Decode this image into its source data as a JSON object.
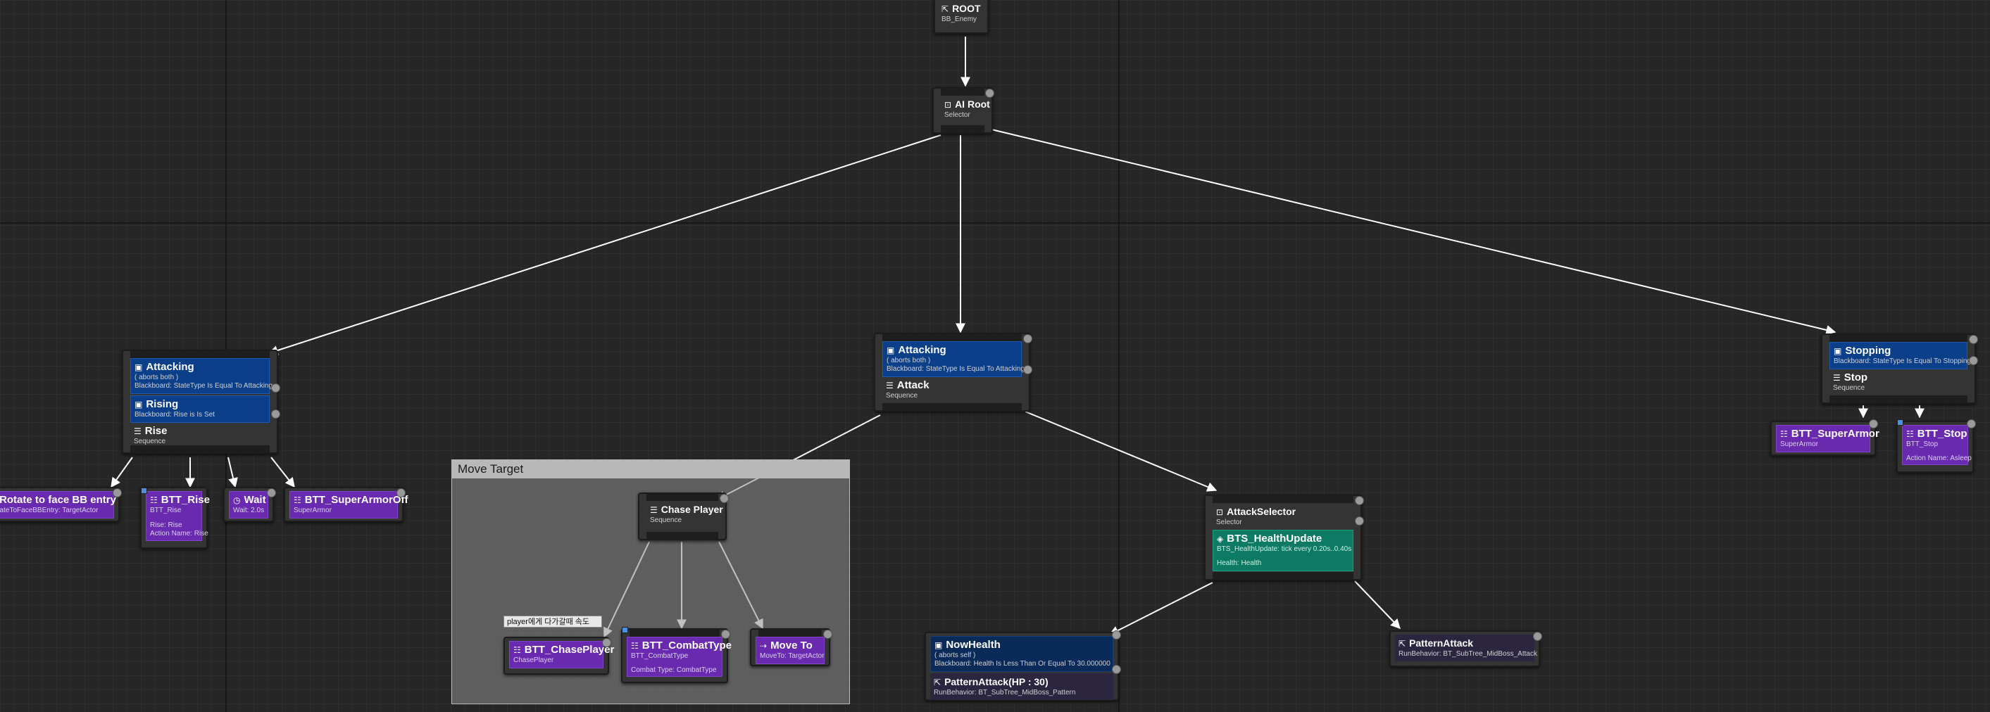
{
  "nodes": {
    "root": {
      "title": "ROOT",
      "sub": "BB_Enemy"
    },
    "ai_root": {
      "title": "AI Root",
      "sub": "Selector"
    },
    "left_branch": {
      "dec1": {
        "title": "Attacking",
        "l1": "( aborts both )",
        "l2": "Blackboard: StateType Is Equal To Attacking"
      },
      "dec2": {
        "title": "Rising",
        "l1": "Blackboard: Rise is Is Set"
      },
      "comp": {
        "title": "Rise",
        "sub": "Sequence"
      }
    },
    "middle_branch": {
      "dec": {
        "title": "Attacking",
        "l1": "( aborts both )",
        "l2": "Blackboard: StateType Is Equal To Attacking"
      },
      "comp": {
        "title": "Attack",
        "sub": "Sequence"
      }
    },
    "right_branch": {
      "dec": {
        "title": "Stopping",
        "l1": "Blackboard: StateType Is Equal To Stopping"
      },
      "comp": {
        "title": "Stop",
        "sub": "Sequence"
      }
    },
    "rotate": {
      "title": "Rotate to face BB entry",
      "sub": "RotateToFaceBBEntry: TargetActor"
    },
    "btt_rise": {
      "title": "BTT_Rise",
      "sub": "BTT_Rise",
      "l1": "Rise: Rise",
      "l2": "Action Name: Rise"
    },
    "wait": {
      "title": "Wait",
      "sub": "Wait: 2.0s"
    },
    "superarmor_off": {
      "title": "BTT_SuperArmorOff",
      "sub": "SuperArmor"
    },
    "chase_player": {
      "title": "Chase Player",
      "sub": "Sequence"
    },
    "btt_chase": {
      "title": "BTT_ChasePlayer",
      "sub": "ChasePlayer"
    },
    "combat_type": {
      "title": "BTT_CombatType",
      "sub": "BTT_CombatType",
      "l1": "Combat Type: CombatType"
    },
    "move_to": {
      "title": "Move To",
      "sub": "MoveTo: TargetActor"
    },
    "attack_selector": {
      "title": "AttackSelector",
      "sub": "Selector"
    },
    "health_update": {
      "title": "BTS_HealthUpdate",
      "l1": "BTS_HealthUpdate: tick every 0.20s..0.40s",
      "l2": "Health: Health"
    },
    "now_health": {
      "title": "NowHealth",
      "l1": "( aborts self )",
      "l2": "Blackboard: Health Is Less Than Or Equal To 30.000000"
    },
    "pattern_hp": {
      "title": "PatternAttack(HP : 30)",
      "sub": "RunBehavior: BT_SubTree_MidBoss_Pattern"
    },
    "pattern_attack": {
      "title": "PatternAttack",
      "sub": "RunBehavior: BT_SubTree_MidBoss_Attack"
    },
    "btt_superarmor": {
      "title": "BTT_SuperArmor",
      "sub": "SuperArmor"
    },
    "btt_stop": {
      "title": "BTT_Stop",
      "sub": "BTT_Stop",
      "l1": "Action Name: Asleep"
    }
  },
  "comment": {
    "title": "Move Target",
    "tag": "player에게 다가갈때 속도"
  },
  "colors": {
    "decorator": "#0b3f8a",
    "service": "#0d7a64",
    "task": "#6a2ab0",
    "composite": "#343434",
    "wire": "#ffffff"
  }
}
